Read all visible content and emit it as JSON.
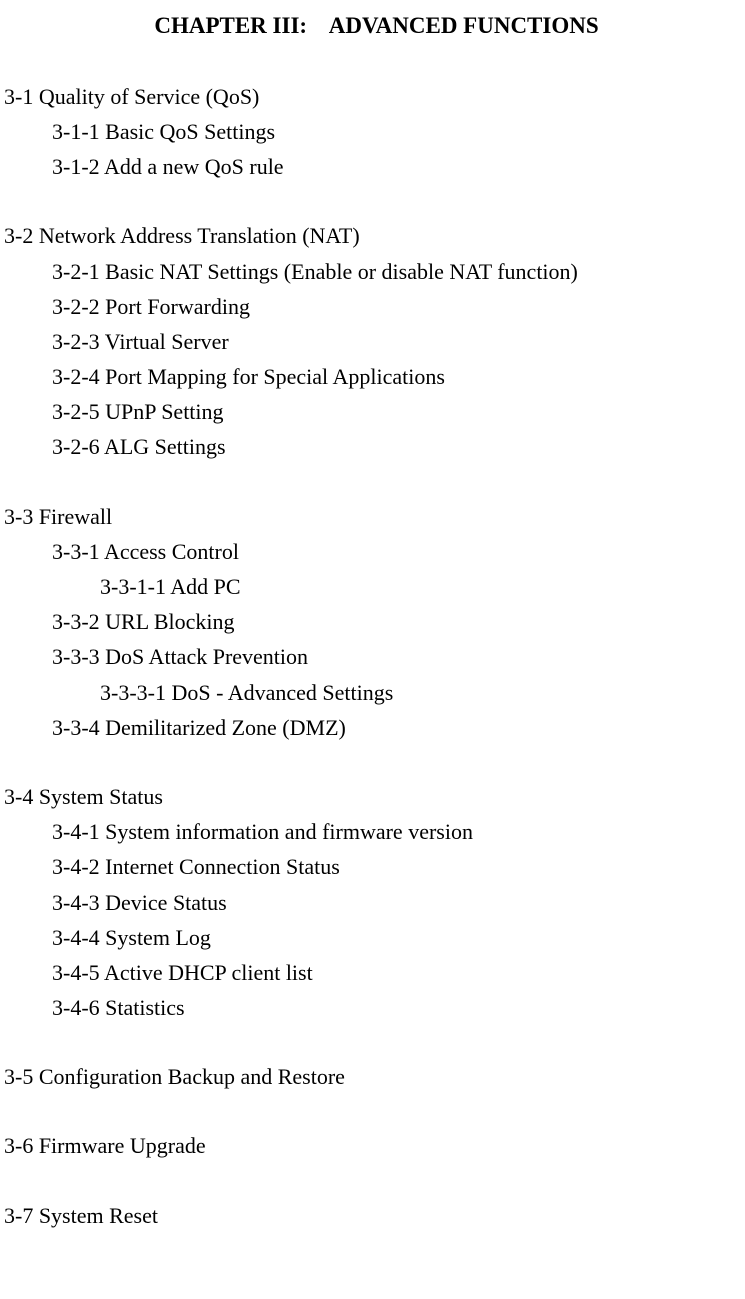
{
  "chapter_title": "CHAPTER III:    ADVANCED FUNCTIONS",
  "toc": {
    "s3_1": {
      "title": "3-1 Quality of Service (QoS)",
      "s3_1_1": "3-1-1 Basic QoS Settings",
      "s3_1_2": "3-1-2 Add a new QoS rule"
    },
    "s3_2": {
      "title": "3-2 Network Address Translation (NAT)",
      "s3_2_1": "3-2-1 Basic NAT Settings (Enable or disable NAT function)",
      "s3_2_2": "3-2-2 Port Forwarding",
      "s3_2_3": "3-2-3 Virtual Server",
      "s3_2_4": "3-2-4 Port Mapping for Special Applications",
      "s3_2_5": "3-2-5 UPnP Setting",
      "s3_2_6": "3-2-6 ALG Settings"
    },
    "s3_3": {
      "title": "3-3 Firewall",
      "s3_3_1": "3-3-1 Access Control",
      "s3_3_1_1": "3-3-1-1 Add PC",
      "s3_3_2": "3-3-2 URL Blocking",
      "s3_3_3": "3-3-3 DoS Attack Prevention",
      "s3_3_3_1": "3-3-3-1 DoS - Advanced Settings",
      "s3_3_4": "3-3-4 Demilitarized Zone (DMZ)"
    },
    "s3_4": {
      "title": "3-4 System Status",
      "s3_4_1": "3-4-1 System information and firmware version",
      "s3_4_2": "3-4-2 Internet Connection Status",
      "s3_4_3": "3-4-3 Device Status",
      "s3_4_4": "3-4-4 System Log",
      "s3_4_5": "3-4-5 Active DHCP client list",
      "s3_4_6": "3-4-6 Statistics"
    },
    "s3_5": {
      "title": "3-5 Configuration Backup and Restore"
    },
    "s3_6": {
      "title": "3-6 Firmware Upgrade"
    },
    "s3_7": {
      "title": "3-7 System Reset"
    }
  }
}
